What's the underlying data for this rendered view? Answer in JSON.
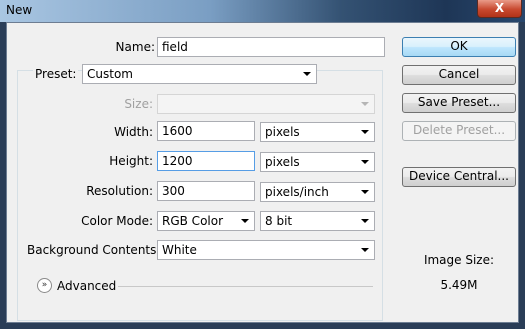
{
  "window": {
    "title": "New",
    "close_glyph": "X"
  },
  "form": {
    "name_label": "Name:",
    "name_value": "field",
    "preset_label": "Preset:",
    "preset_value": "Custom",
    "size_label": "Size:",
    "size_value": "",
    "width_label": "Width:",
    "width_value": "1600",
    "width_unit": "pixels",
    "height_label": "Height:",
    "height_value": "1200",
    "height_unit": "pixels",
    "resolution_label": "Resolution:",
    "resolution_value": "300",
    "resolution_unit": "pixels/inch",
    "color_mode_label": "Color Mode:",
    "color_mode_value": "RGB Color",
    "bit_depth_value": "8 bit",
    "background_label": "Background Contents:",
    "background_value": "White",
    "advanced_label": "Advanced"
  },
  "buttons": {
    "ok": "OK",
    "cancel": "Cancel",
    "save_preset": "Save Preset...",
    "delete_preset": "Delete Preset...",
    "device_central": "Device Central..."
  },
  "info": {
    "image_size_label": "Image Size:",
    "image_size_value": "5.49M"
  },
  "colors": {
    "accent": "#3c7fb1",
    "focus": "#569de5",
    "dialog_bg": "#f0f0f0"
  }
}
